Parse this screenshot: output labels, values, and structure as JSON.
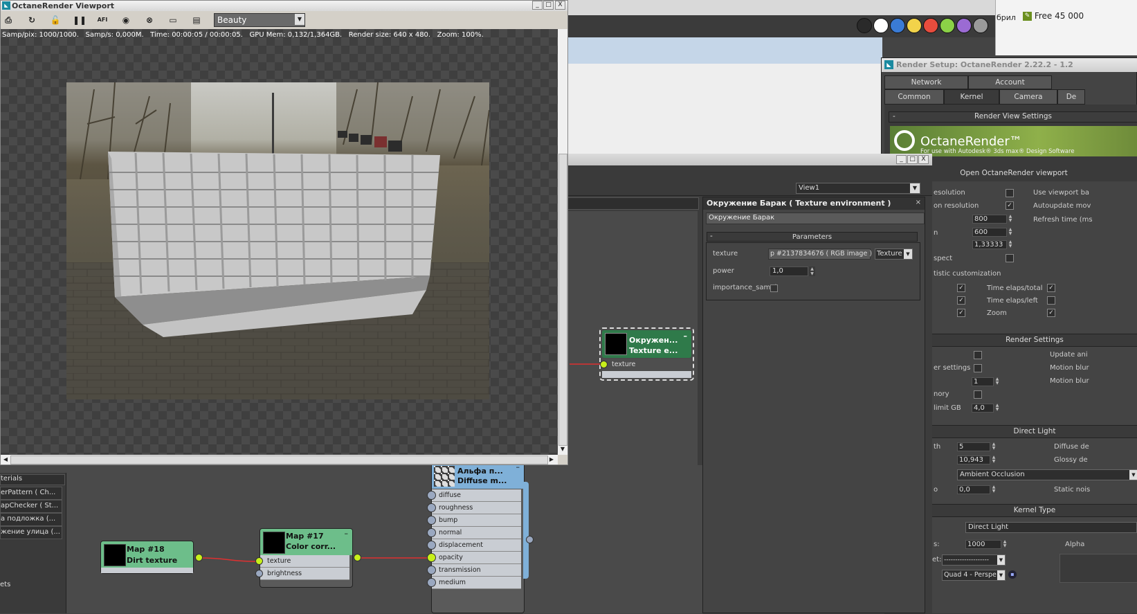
{
  "viewport": {
    "title": "OctaneRender Viewport",
    "pass_select": "Beauty",
    "status": "Samp/pix: 1000/1000.   Samp/s: 0,000M.   Time: 00:00:05 / 00:00:05.   GPU Mem: 0,132/1,364GB.   Render size: 640 x 480.   Zoom: 100%.",
    "toolbar_icons": [
      "save-icon",
      "refresh-icon",
      "lock-icon",
      "pause-icon",
      "afi-icon",
      "color-picker-icon",
      "stop-render-icon",
      "monitor-icon",
      "film-icon"
    ],
    "afi_label": "AFI",
    "window_buttons": [
      "_",
      "□",
      "X"
    ]
  },
  "top_bar": {
    "color_swatches": [
      "#2a2a2a",
      "#ffffff",
      "#3a7bd5",
      "#f2d34a",
      "#e84c3d",
      "#8bd147",
      "#9b6bd3",
      "#9a9a9a"
    ],
    "text_fragment": "брил",
    "free_label": "Free 45 000"
  },
  "render_setup": {
    "title": "Render Setup: OctaneRender 2.22.2 - 1.2",
    "tabs_row1": [
      "Network",
      "Account"
    ],
    "tabs_row2": [
      "Common",
      "Kernel",
      "Camera",
      "De"
    ],
    "active_tab": "Kernel",
    "section_view": "Render View Settings",
    "brand": "OctaneRender™",
    "brand_sub": "For use with Autodesk® 3ds max® Design Software",
    "open_viewport": "Open OctaneRender viewport",
    "left_labels": [
      "esolution",
      "on resolution",
      "n",
      "",
      "spect",
      "tistic customization"
    ],
    "res_values": [
      "800",
      "600",
      "1,33333"
    ],
    "right_labels": [
      "Use viewport ba",
      "Autoupdate mov",
      "Refresh time (ms"
    ],
    "stats_checks": [
      "Time elaps/total",
      "Time elaps/left",
      "Zoom"
    ],
    "section_render": "Render Settings",
    "rs_left": [
      "er settings",
      "",
      "nory",
      "limit GB"
    ],
    "rs_right": [
      "Update ani",
      "Motion blur",
      "Motion blur"
    ],
    "rs_values": [
      "1",
      "4,0"
    ],
    "section_direct": "Direct Light",
    "dl_values": [
      "5",
      "10,943"
    ],
    "dl_left": [
      "th",
      "",
      "o"
    ],
    "dl_right": [
      "Diffuse de",
      "Glossy de",
      "Static nois"
    ],
    "gi_mode": "Ambient Occlusion",
    "ao_value": "0,0",
    "section_kernel": "Kernel Type",
    "kernel_type": "Direct Light",
    "samples": "1000",
    "alpha_label": "Alpha",
    "preset_left": "et:",
    "preset_value": "--------------------",
    "camera_value": "Quad 4 - Perspe",
    "left_fragment_s": "s:"
  },
  "material_editor": {
    "view_select": "View1",
    "panel_title": "Окружение Барак  ( Texture environment )",
    "name_field": "Окружение Барак",
    "params_title": "Parameters",
    "texture_label": "texture",
    "texture_value": "p #2137834676  ( RGB image )",
    "texture_type": "Texture",
    "power_label": "power",
    "power_value": "1,0",
    "importance_label": "importance_sampl"
  },
  "material_list": {
    "header": "terials",
    "items": [
      "erPattern  ( Ch...",
      "apChecker  ( St...",
      "а подложка  (...",
      "жение улица  (..."
    ],
    "footer": "ets"
  },
  "nodes": {
    "env_node": {
      "line1": "Окружен...",
      "line2": "Texture e...",
      "slot": "texture"
    },
    "map18": {
      "line1": "Map #18",
      "line2": "Dirt texture"
    },
    "map17": {
      "line1": "Map #17",
      "line2": "Color corr...",
      "slots": [
        "texture",
        "brightness"
      ]
    },
    "diffuse": {
      "line1": "Альфа  п...",
      "line2": "Diffuse m...",
      "slots": [
        "diffuse",
        "roughness",
        "bump",
        "normal",
        "displacement",
        "opacity",
        "transmission",
        "medium"
      ]
    }
  }
}
